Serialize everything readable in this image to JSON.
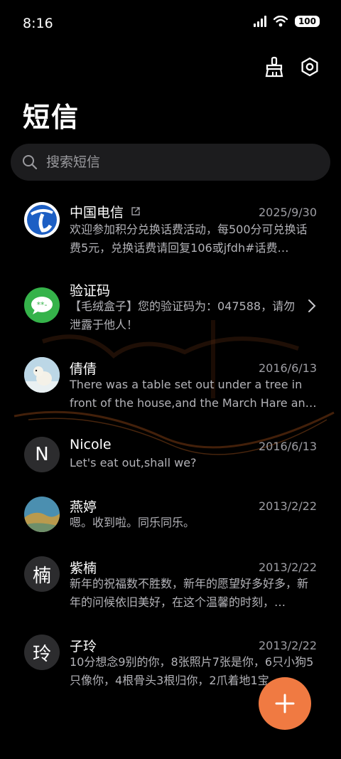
{
  "status": {
    "time": "8:16",
    "battery": "100"
  },
  "header": {
    "title": "短信"
  },
  "search": {
    "placeholder": "搜索短信"
  },
  "colors": {
    "accent": "#f07a42",
    "background": "#000000",
    "search_bg": "#1c1c1e"
  },
  "messages": [
    {
      "name": "中国电信",
      "date": "2025/9/30",
      "preview": "欢迎参加积分兑换话费活动，每500分可兑换话费5元，兑换话费请回复106或jfdh#话费…",
      "avatar_icon": "china-telecom-logo"
    },
    {
      "name": "验证码",
      "date": "",
      "preview": "【毛绒盒子】您的验证码为：047588，请勿泄露于他人！",
      "avatar_icon": "message-bubble-icon"
    },
    {
      "name": "倩倩",
      "date": "2016/6/13",
      "preview": "There was a table set out under a tree in front of the house,and the March Hare an…",
      "avatar_icon": "polar-bear-photo"
    },
    {
      "name": "Nicole",
      "date": "2016/6/13",
      "preview": "Let's eat out,shall we?",
      "avatar_letter": "N"
    },
    {
      "name": "燕婷",
      "date": "2013/2/22",
      "preview": "嗯。收到啦。同乐同乐。",
      "avatar_icon": "landscape-photo"
    },
    {
      "name": "紫楠",
      "date": "2013/2/22",
      "preview": "新年的祝福数不胜数，新年的愿望好多好多，新年的问候依旧美好，在这个温馨的时刻，…",
      "avatar_letter": "楠"
    },
    {
      "name": "子玲",
      "date": "2013/2/22",
      "preview": "10分想念9别的你，8张照片7张是你，6只小狗5只像你，4根骨头3根归你，2爪着地1宝…",
      "avatar_letter": "玲"
    }
  ],
  "fab": {
    "icon": "plus-icon"
  }
}
